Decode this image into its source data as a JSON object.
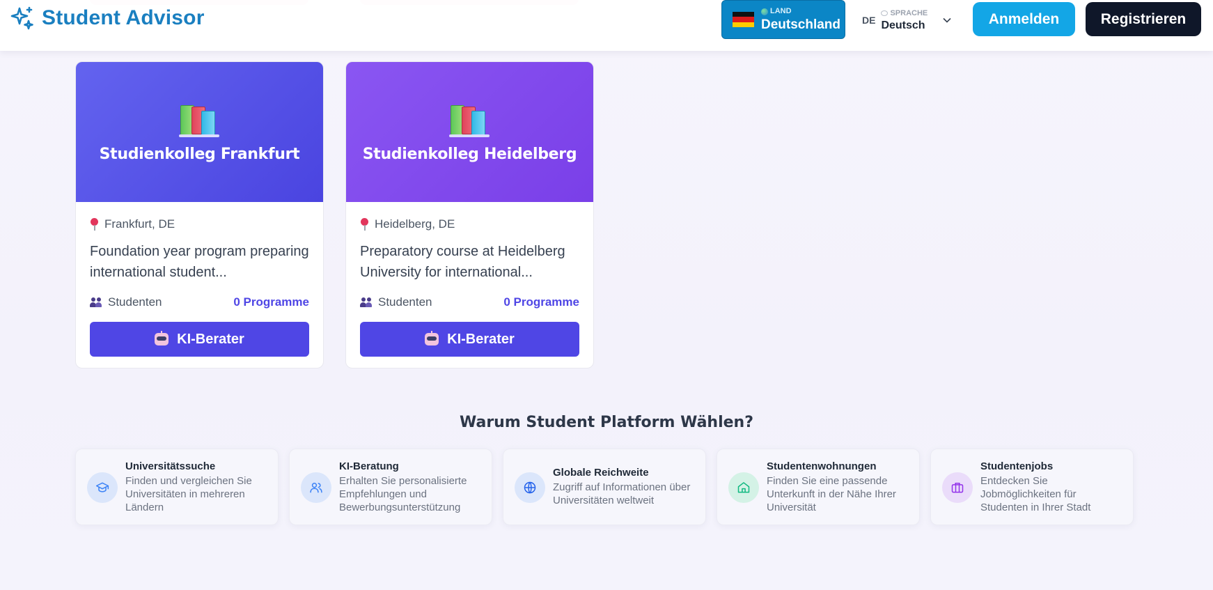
{
  "header": {
    "brand": "Student Advisor",
    "country": {
      "label": "LAND",
      "value": "Deutschland"
    },
    "language": {
      "code": "DE",
      "label": "SPRACHE",
      "value": "Deutsch"
    },
    "login_label": "Anmelden",
    "register_label": "Registrieren"
  },
  "cards": [
    {
      "title": "Studienkolleg Frankfurt",
      "location": "Frankfurt, DE",
      "description": "Foundation year program preparing international student...",
      "students_label": "Studenten",
      "programs": "0 Programme",
      "button_label": "KI-Berater"
    },
    {
      "title": "Studienkolleg Heidelberg",
      "location": "Heidelberg, DE",
      "description": "Preparatory course at Heidelberg University for international...",
      "students_label": "Studenten",
      "programs": "0 Programme",
      "button_label": "KI-Berater"
    }
  ],
  "features_section": {
    "title": "Warum Student Platform Wählen?",
    "items": [
      {
        "title": "Universitätssuche",
        "description": "Finden und vergleichen Sie Universitäten in mehreren Ländern",
        "icon": "graduation-cap-icon",
        "color": "#3b82f6"
      },
      {
        "title": "KI-Beratung",
        "description": "Erhalten Sie personalisierte Empfehlungen und Bewerbungsunterstützung",
        "icon": "users-icon",
        "color": "#3b82f6"
      },
      {
        "title": "Globale Reichweite",
        "description": "Zugriff auf Informationen über Universitäten weltweit",
        "icon": "globe-icon",
        "color": "#2563eb"
      },
      {
        "title": "Studentenwohnungen",
        "description": "Finden Sie eine passende Unterkunft in der Nähe Ihrer Universität",
        "icon": "home-icon",
        "color": "#10b981"
      },
      {
        "title": "Studentenjobs",
        "description": "Entdecken Sie Jobmöglichkeiten für Studenten in Ihrer Stadt",
        "icon": "briefcase-icon",
        "color": "#9333ea"
      }
    ]
  },
  "colors": {
    "brand": "#1a7fc0",
    "country_button": "#0b86c6",
    "login_button": "#13a6e6",
    "register_button": "#0f1729",
    "primary": "#4f46e5"
  }
}
